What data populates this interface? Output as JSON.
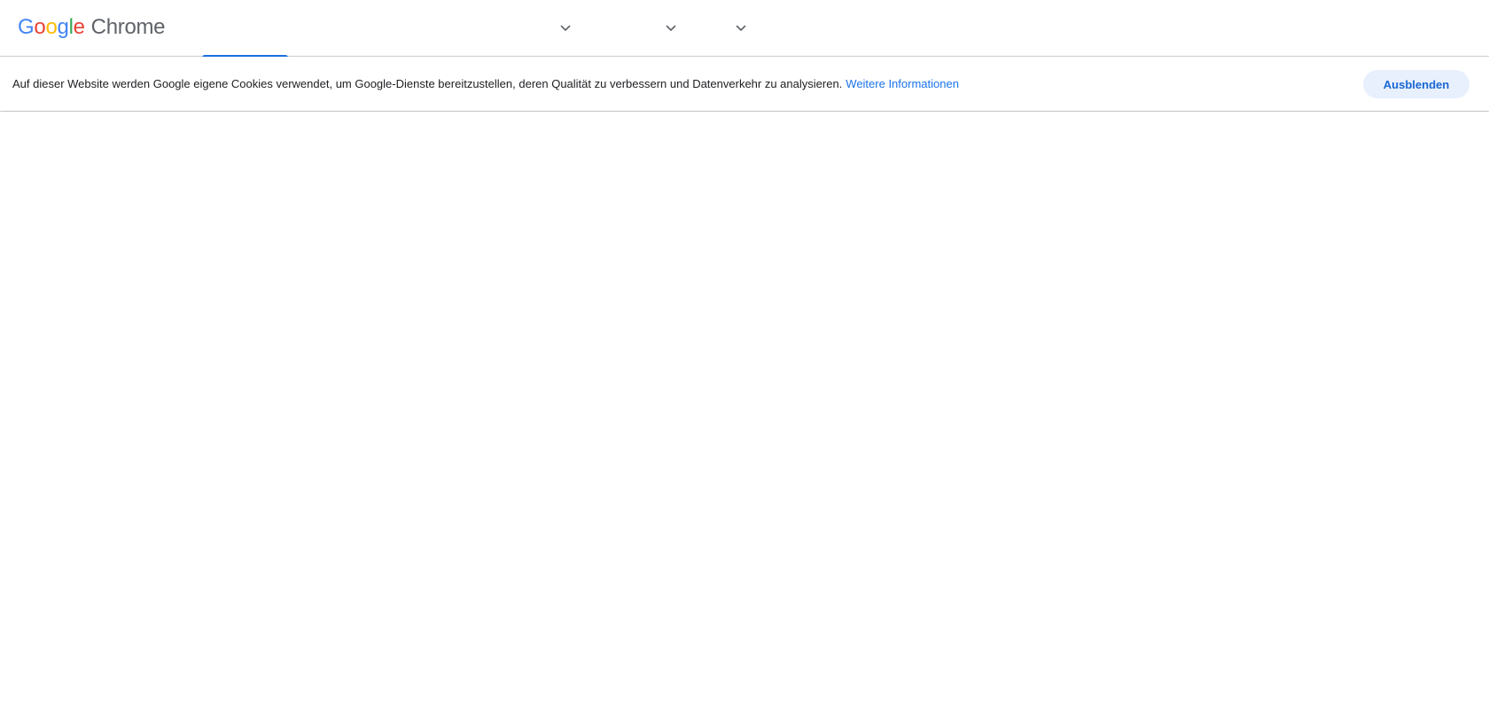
{
  "header": {
    "logo": {
      "google_letters": [
        {
          "char": "G",
          "color": "#4285F4"
        },
        {
          "char": "o",
          "color": "#EA4335"
        },
        {
          "char": "o",
          "color": "#FBBC05"
        },
        {
          "char": "g",
          "color": "#4285F4"
        },
        {
          "char": "l",
          "color": "#34A853"
        },
        {
          "char": "e",
          "color": "#EA4335"
        }
      ],
      "product": "Chrome"
    },
    "nav_dropdowns": [
      {
        "icon": "chevron-down-icon"
      },
      {
        "icon": "chevron-down-icon"
      },
      {
        "icon": "chevron-down-icon"
      }
    ],
    "accent_color": "#1a73e8"
  },
  "cookie_banner": {
    "text": "Auf dieser Website werden Google eigene Cookies verwendet, um Google-Dienste bereitzustellen, deren Qualität zu verbessern und Datenverkehr zu analysieren.",
    "link_label": "Weitere Informationen",
    "button_label": "Ausblenden",
    "link_color": "#1a73e8",
    "button_bg": "#e8f0fe"
  }
}
